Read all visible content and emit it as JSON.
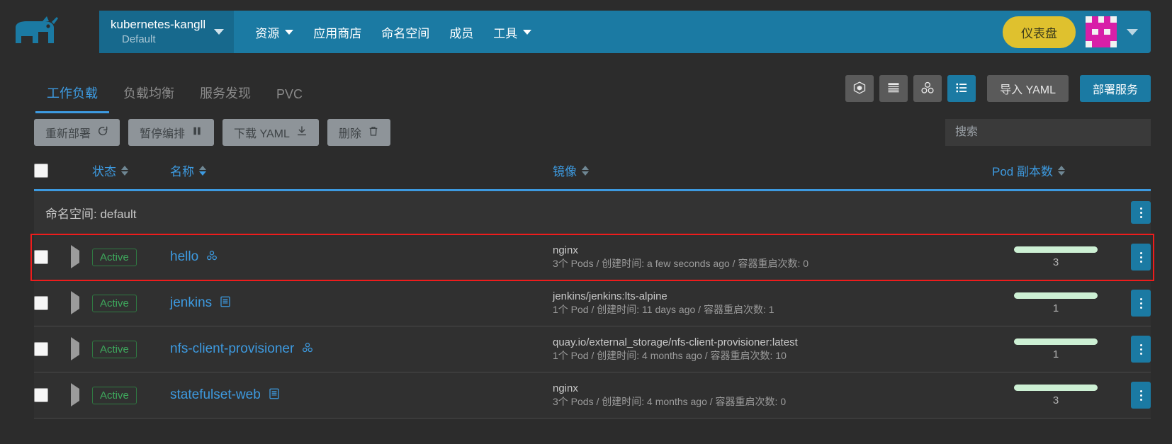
{
  "header": {
    "logo_icon": "rancher-cow-logo",
    "cluster": {
      "name": "kubernetes-kangll",
      "sub": "Default",
      "caret_icon": "chevron-down-icon"
    },
    "nav": [
      {
        "label": "资源",
        "has_caret": true,
        "caret_icon": "chevron-down-icon"
      },
      {
        "label": "应用商店",
        "has_caret": false
      },
      {
        "label": "命名空间",
        "has_caret": false
      },
      {
        "label": "成员",
        "has_caret": false
      },
      {
        "label": "工具",
        "has_caret": true,
        "caret_icon": "chevron-down-icon"
      }
    ],
    "dashboard_button": "仪表盘",
    "avatar_icon": "user-identicon-avatar",
    "avatar_color": "#d81fa8",
    "user_caret_icon": "chevron-down-icon"
  },
  "tabs": [
    {
      "label": "工作负载",
      "active": true
    },
    {
      "label": "负载均衡",
      "active": false
    },
    {
      "label": "服务发现",
      "active": false
    },
    {
      "label": "PVC",
      "active": false
    }
  ],
  "view_buttons": [
    {
      "icon": "cube-icon",
      "active": false
    },
    {
      "icon": "stack-lines-icon",
      "active": false
    },
    {
      "icon": "workload-group-icon",
      "active": false
    },
    {
      "icon": "list-view-icon",
      "active": true
    }
  ],
  "toolbar": {
    "import_yaml": "导入 YAML",
    "deploy_service": "部署服务"
  },
  "actions": [
    {
      "label": "重新部署",
      "icon": "refresh-icon"
    },
    {
      "label": "暂停编排",
      "icon": "pause-icon"
    },
    {
      "label": "下载 YAML",
      "icon": "download-icon"
    },
    {
      "label": "删除",
      "icon": "trash-icon"
    }
  ],
  "search": {
    "placeholder": "搜索",
    "value": ""
  },
  "table": {
    "headers": {
      "state": "状态",
      "name": "名称",
      "image": "镜像",
      "pods": "Pod 副本数"
    },
    "group": {
      "key": "命名空间:",
      "value": "default"
    },
    "rows": [
      {
        "state": "Active",
        "name": "hello",
        "type_icon": "deployment-icon",
        "image": "nginx",
        "detail": "3个 Pods / 创建时间: a few seconds ago / 容器重启次数: 0",
        "pod_count": "3",
        "highlighted": true
      },
      {
        "state": "Active",
        "name": "jenkins",
        "type_icon": "statefulset-icon",
        "image": "jenkins/jenkins:lts-alpine",
        "detail": "1个 Pod / 创建时间: 11 days ago / 容器重启次数: 1",
        "pod_count": "1",
        "highlighted": false
      },
      {
        "state": "Active",
        "name": "nfs-client-provisioner",
        "type_icon": "deployment-icon",
        "image": "quay.io/external_storage/nfs-client-provisioner:latest",
        "detail": "1个 Pod / 创建时间: 4 months ago / 容器重启次数: 10",
        "pod_count": "1",
        "highlighted": false
      },
      {
        "state": "Active",
        "name": "statefulset-web",
        "type_icon": "statefulset-icon",
        "image": "nginx",
        "detail": "3个 Pods / 创建时间: 4 months ago / 容器重启次数: 0",
        "pod_count": "3",
        "highlighted": false
      }
    ]
  },
  "colors": {
    "accent_blue": "#1b7aa3",
    "link_blue": "#3d9ae0",
    "dashboard_yellow": "#dfc12e",
    "active_green": "#3ea75c",
    "bar_green": "#cdf0d4",
    "highlight_red": "#ee1c1c"
  }
}
